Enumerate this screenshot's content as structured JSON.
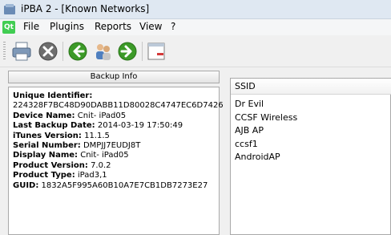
{
  "window": {
    "title": "iPBA 2 - [Known Networks]"
  },
  "menu": {
    "logo": "Qt",
    "items": [
      "File",
      "Plugins",
      "Reports",
      "View",
      "?"
    ]
  },
  "toolbar": {
    "icons": [
      "printer-icon",
      "close-circle-icon",
      "back-arrow-icon",
      "users-icon",
      "forward-arrow-icon",
      "window-icon"
    ]
  },
  "backup_info": {
    "header": "Backup Info",
    "lines": [
      {
        "label": "Unique Identifier:",
        "value": ""
      },
      {
        "label": "",
        "value": "224328F7BC48D90DABB11D80028C4747EC6D7426"
      },
      {
        "label": "Device Name:",
        "value": "Cnit- iPad05"
      },
      {
        "label": "Last Backup Date:",
        "value": "2014-03-19 17:50:49"
      },
      {
        "label": "iTunes Version:",
        "value": "11.1.5"
      },
      {
        "label": "Serial Number:",
        "value": "DMPJJ7EUDJ8T"
      },
      {
        "label": "Display Name:",
        "value": "Cnit- iPad05"
      },
      {
        "label": "Product Version:",
        "value": "7.0.2"
      },
      {
        "label": "Product Type:",
        "value": "iPad3,1"
      },
      {
        "label": "GUID:",
        "value": "1832A5F995A60B10A7E7CB1DB7273E27"
      }
    ]
  },
  "networks": {
    "column_header": "SSID",
    "items": [
      "Dr Evil",
      "CCSF Wireless",
      "AJB AP",
      "ccsf1",
      "AndroidAP"
    ]
  },
  "colors": {
    "titlebar": "#dfe8f2",
    "qt_green": "#41cd52",
    "arrow_green": "#3c9a28"
  }
}
